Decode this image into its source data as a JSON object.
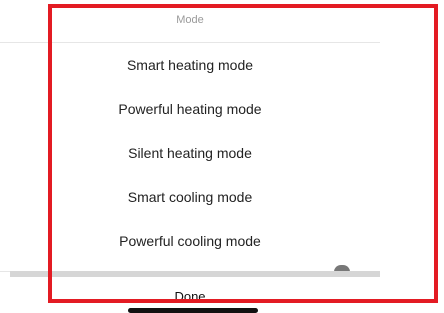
{
  "picker": {
    "title": "Mode",
    "options": [
      "Smart heating mode",
      "Powerful heating mode",
      "Silent heating mode",
      "Smart cooling mode",
      "Powerful cooling mode"
    ],
    "done_label": "Done"
  },
  "colors": {
    "highlight": "#e31b23",
    "divider": "#e6e6e6",
    "title_text": "#9a9a9a",
    "option_text": "#222222"
  }
}
